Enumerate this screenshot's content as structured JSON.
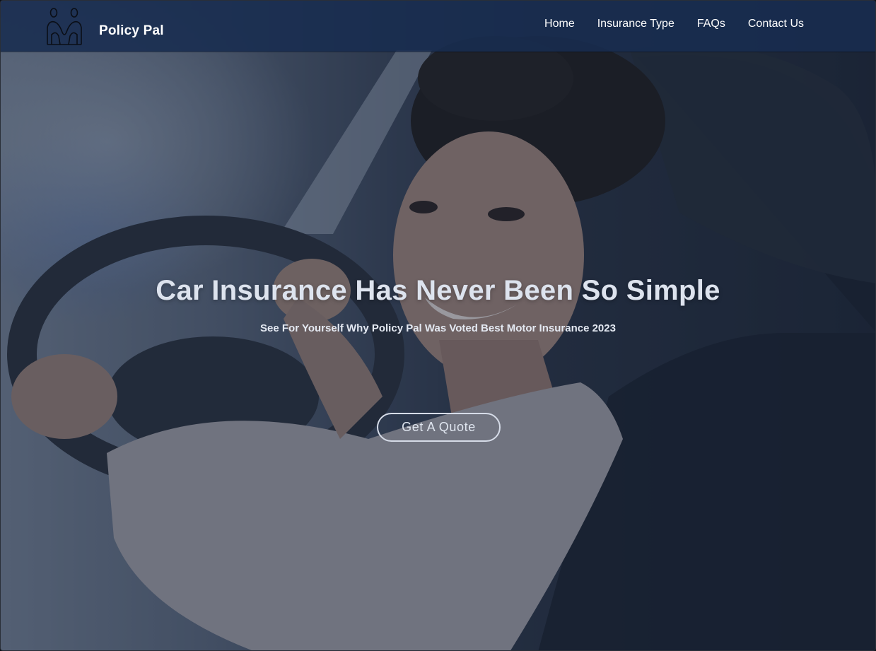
{
  "brand": {
    "name": "Policy Pal",
    "logo_icon": "two-people-hugging-icon"
  },
  "nav": {
    "items": [
      {
        "label": "Home"
      },
      {
        "label": "Insurance Type"
      },
      {
        "label": "FAQs"
      },
      {
        "label": "Contact Us"
      }
    ]
  },
  "hero": {
    "title": "Car Insurance Has Never Been So Simple",
    "subtitle": "See For Yourself Why Policy Pal Was Voted Best Motor Insurance 2023",
    "cta_label": "Get A Quote",
    "background_image": "woman-smiling-at-steering-wheel-photo"
  },
  "colors": {
    "navbar": "#1b3153",
    "overlay": "#142440",
    "text_primary": "#ffffff",
    "hero_text": "#dde3ee"
  }
}
